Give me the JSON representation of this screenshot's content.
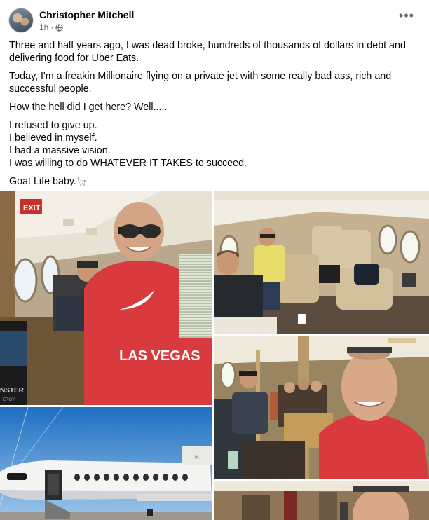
{
  "post": {
    "author": "Christopher Mitchell",
    "time": "1h",
    "privacy_icon": "globe-icon",
    "more_icon": "more-dots-icon",
    "more_label": "•••",
    "paragraphs": [
      "Three and half years ago, I was dead broke, hundreds of thousands of dollars in debt and delivering food for Uber Eats.",
      "Today, I'm a freakin Millionaire flying on a private jet with some really bad ass, rich and successful people.",
      "How the hell did I get here? Well....."
    ],
    "lines": [
      "I refused to give up.",
      "I believed in myself.",
      "I had a massive vision.",
      "I was willing to do WHATEVER IT TAKES to succeed."
    ],
    "closing": "Goat Life baby.",
    "closing_icon": "llama-emoji-icon",
    "closing_emoji": "🦙"
  },
  "photos": {
    "photo1": {
      "exit_sign": "EXIT",
      "hoodie_text": "LAS VEGAS",
      "can_text": "NSTER",
      "can_sub": "ERGY"
    },
    "photo2": {},
    "photo3": {},
    "photo4": {},
    "photo5": {}
  }
}
